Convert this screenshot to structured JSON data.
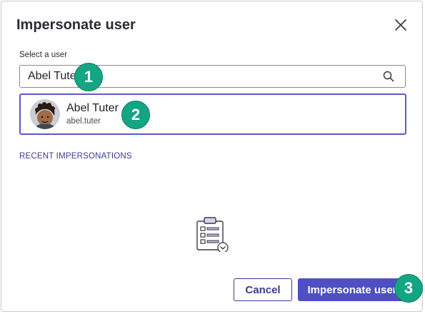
{
  "dialog": {
    "title": "Impersonate user",
    "close_icon": "close-icon"
  },
  "select": {
    "label": "Select a user",
    "value": "Abel Tuter",
    "icon": "search-icon"
  },
  "result": {
    "name": "Abel Tuter",
    "username": "abel.tuter",
    "avatar_icon": "avatar"
  },
  "recent": {
    "heading": "RECENT IMPERSONATIONS",
    "empty_icon": "clipboard-list-icon"
  },
  "buttons": {
    "cancel": "Cancel",
    "impersonate": "Impersonate user"
  },
  "steps": {
    "one": "1",
    "two": "2",
    "three": "3"
  },
  "colors": {
    "primary": "#4f4fc4",
    "accent_text": "#3a3d8f",
    "step_badge": "#14a585",
    "selected_border": "#5a5cc2"
  }
}
